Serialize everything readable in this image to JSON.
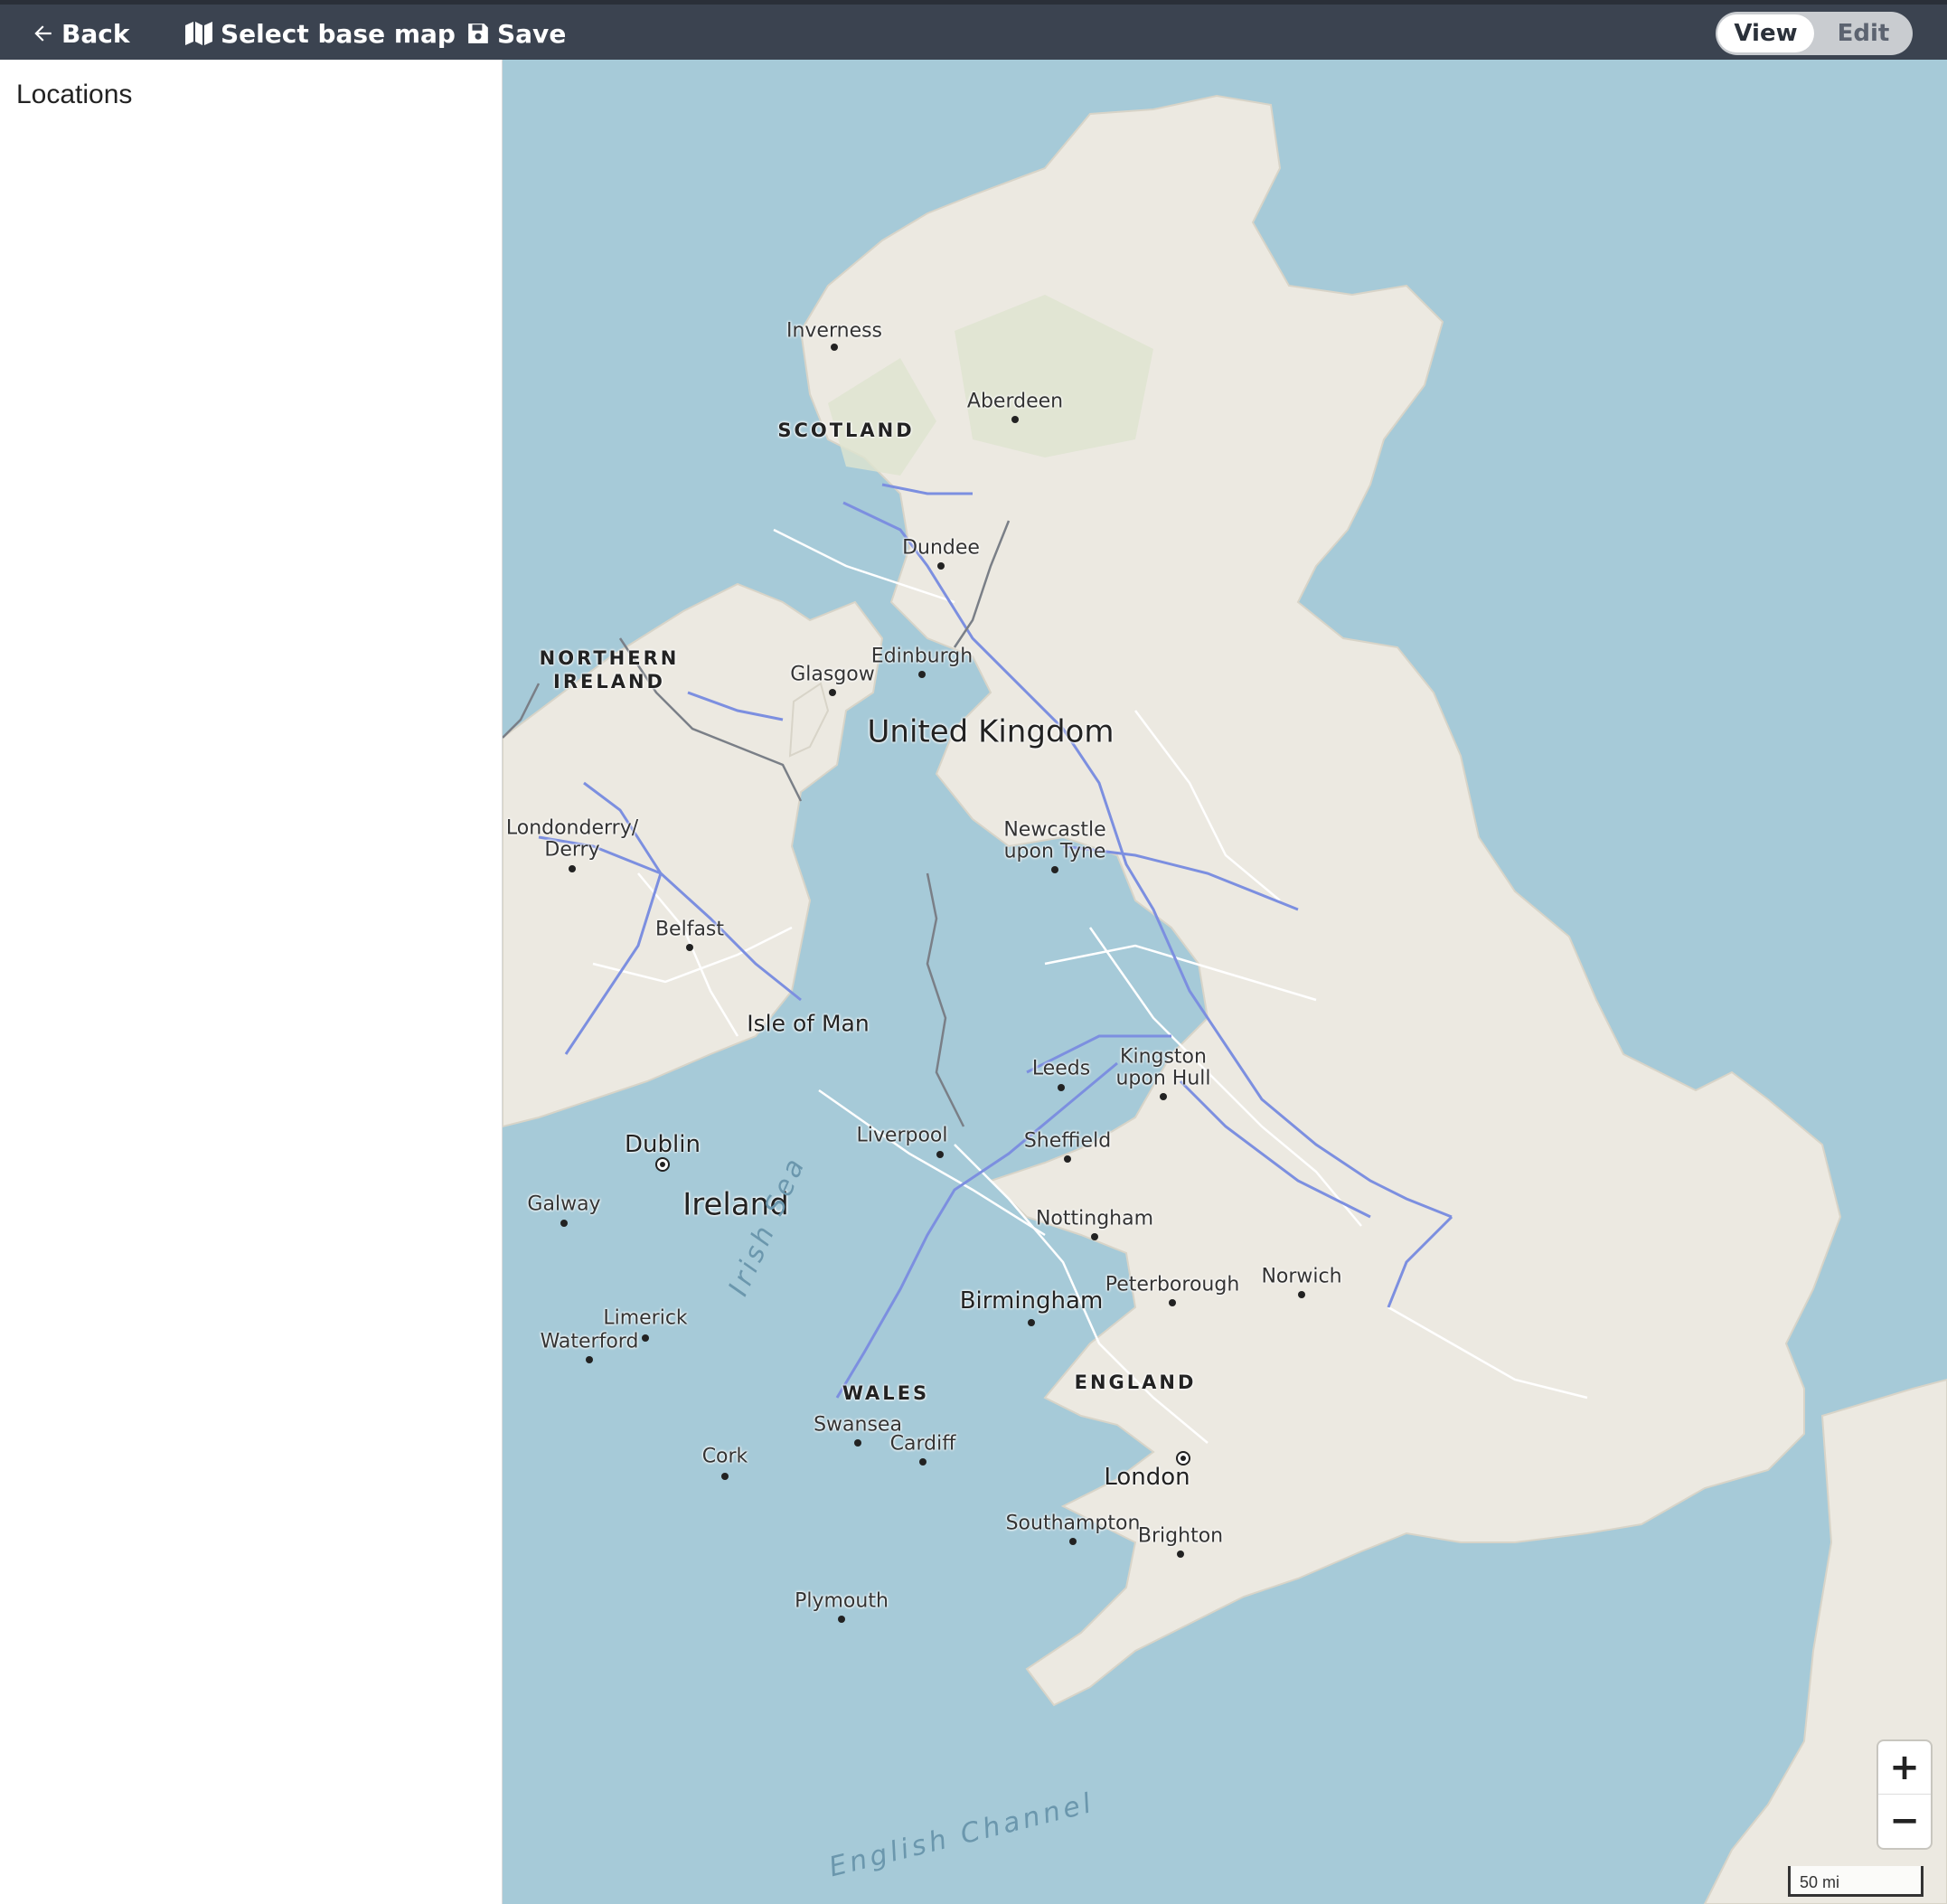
{
  "toolbar": {
    "back_label": "Back",
    "basemap_label": "Select base map",
    "save_label": "Save",
    "view_label": "View",
    "edit_label": "Edit",
    "active_mode": "View"
  },
  "sidebar": {
    "title": "Locations"
  },
  "map": {
    "colors": {
      "water": "#a6cad8",
      "land": "#ece9e1",
      "motorway": "#7c8fe0",
      "road": "#ffffff",
      "border": "#7a7f87"
    },
    "countries": {
      "uk": "United Kingdom",
      "ireland": "Ireland"
    },
    "regions": {
      "scotland": "SCOTLAND",
      "northern_ireland_1": "NORTHERN",
      "northern_ireland_2": "IRELAND",
      "wales": "WALES",
      "england": "ENGLAND"
    },
    "seas": {
      "irish_sea": "Irish Sea",
      "english_channel": "English Channel"
    },
    "islands": {
      "isle_of_man": "Isle of Man"
    },
    "cities": {
      "inverness": "Inverness",
      "aberdeen": "Aberdeen",
      "dundee": "Dundee",
      "edinburgh": "Edinburgh",
      "glasgow": "Glasgow",
      "derry_1": "Londonderry/",
      "derry_2": "Derry",
      "belfast": "Belfast",
      "newcastle_1": "Newcastle",
      "newcastle_2": "upon Tyne",
      "leeds": "Leeds",
      "hull_1": "Kingston",
      "hull_2": "upon Hull",
      "liverpool": "Liverpool",
      "sheffield": "Sheffield",
      "nottingham": "Nottingham",
      "dublin": "Dublin",
      "galway": "Galway",
      "limerick": "Limerick",
      "waterford": "Waterford",
      "cork": "Cork",
      "birmingham": "Birmingham",
      "peterborough": "Peterborough",
      "norwich": "Norwich",
      "swansea": "Swansea",
      "cardiff": "Cardiff",
      "london": "London",
      "southampton": "Southampton",
      "brighton": "Brighton",
      "plymouth": "Plymouth"
    },
    "zoom_in_label": "+",
    "zoom_out_label": "−",
    "scale_label": "50 mi"
  }
}
